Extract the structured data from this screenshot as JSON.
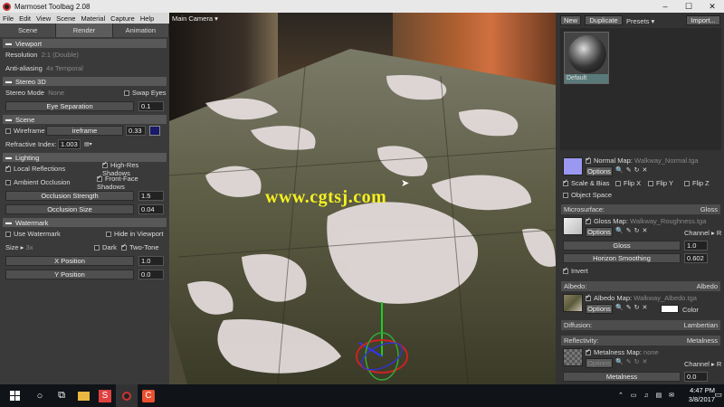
{
  "app": {
    "title": "Marmoset Toolbag 2.08"
  },
  "window_controls": {
    "minimize": "–",
    "maximize": "☐",
    "close": "✕"
  },
  "menu": [
    "File",
    "Edit",
    "View",
    "Scene",
    "Material",
    "Capture",
    "Help"
  ],
  "left_tabs": [
    "Scene",
    "Render",
    "Animation"
  ],
  "viewport": {
    "camera_label": "Main Camera ▾",
    "watermark": "www.cgtsj.com"
  },
  "render_panel": {
    "viewport": {
      "title": "Viewport",
      "resolution_label": "Resolution",
      "resolution_value": "2:1 (Double)",
      "aa_label": "Anti-aliasing",
      "aa_value": "4x Temporal"
    },
    "stereo": {
      "title": "Stereo 3D",
      "mode_label": "Stereo Mode",
      "mode_value": "None",
      "swap_label": "Swap Eyes",
      "eye_sep_label": "Eye Separation",
      "eye_sep_value": "0.1"
    },
    "scene": {
      "title": "Scene",
      "wireframe_label": "Wireframe",
      "wireframe_slider": "ireframe",
      "wireframe_value": "0.33",
      "wireframe_color": "#1a1a6a",
      "refr_label": "Refractive Index:",
      "refr_value": "1.003"
    },
    "lighting": {
      "title": "Lighting",
      "local_refl": "Local Reflections",
      "high_res": "High-Res Shadows",
      "ambient_occ": "Ambient Occlusion",
      "front_face": "Front-Face Shadows",
      "occ_strength_label": "Occlusion Strength",
      "occ_strength_value": "1.5",
      "occ_size_label": "Occlusion Size",
      "occ_size_value": "0.04"
    },
    "watermark": {
      "title": "Watermark",
      "use_label": "Use Watermark",
      "hide_label": "Hide in Viewport",
      "size_label": "Size",
      "size_value": "3x",
      "dark_label": "Dark",
      "two_tone_label": "Two-Tone",
      "xpos_label": "X Position",
      "xpos_value": "1.0",
      "ypos_label": "Y Position",
      "ypos_value": "0.0"
    }
  },
  "material_panel": {
    "new_label": "New",
    "duplicate_label": "Duplicate",
    "presets_label": "Presets ▾",
    "import_label": "Import...",
    "material_name": "Default",
    "normal": {
      "map_label": "Normal Map:",
      "map_file": "Walkway_Normal.tga",
      "options": "Options",
      "scale_bias": "Scale & Bias",
      "flip_x": "Flip X",
      "flip_y": "Flip Y",
      "flip_z": "Flip Z",
      "object_space": "Object Space"
    },
    "microsurface": {
      "title": "Microsurface:",
      "mode": "Gloss",
      "map_label": "Gloss Map:",
      "map_file": "Walkway_Roughness.tga",
      "options": "Options",
      "channel_label": "Channel",
      "channel_value": "R",
      "gloss_label": "Gloss",
      "gloss_value": "1.0",
      "horizon_label": "Horizon Smoothing",
      "horizon_value": "0.602",
      "invert_label": "Invert"
    },
    "albedo": {
      "title": "Albedo:",
      "mode": "Albedo",
      "map_label": "Albedo Map:",
      "map_file": "Walkway_Albedo.tga",
      "options": "Options",
      "color_label": "Color"
    },
    "diffusion": {
      "title": "Diffusion:",
      "mode": "Lambertian"
    },
    "reflectivity": {
      "title": "Reflectivity:",
      "mode": "Metalness",
      "map_label": "Metalness Map:",
      "map_value": "none",
      "options": "Options",
      "channel_label": "Channel",
      "channel_value": "R",
      "metalness_label": "Metalness",
      "metalness_value": "0.0"
    }
  },
  "taskbar": {
    "windows_icon": "windows-logo",
    "clock_time": "4:47 PM",
    "clock_date": "3/8/2017",
    "tray": "⌃ ▭ ♫ ▤ ✉"
  }
}
